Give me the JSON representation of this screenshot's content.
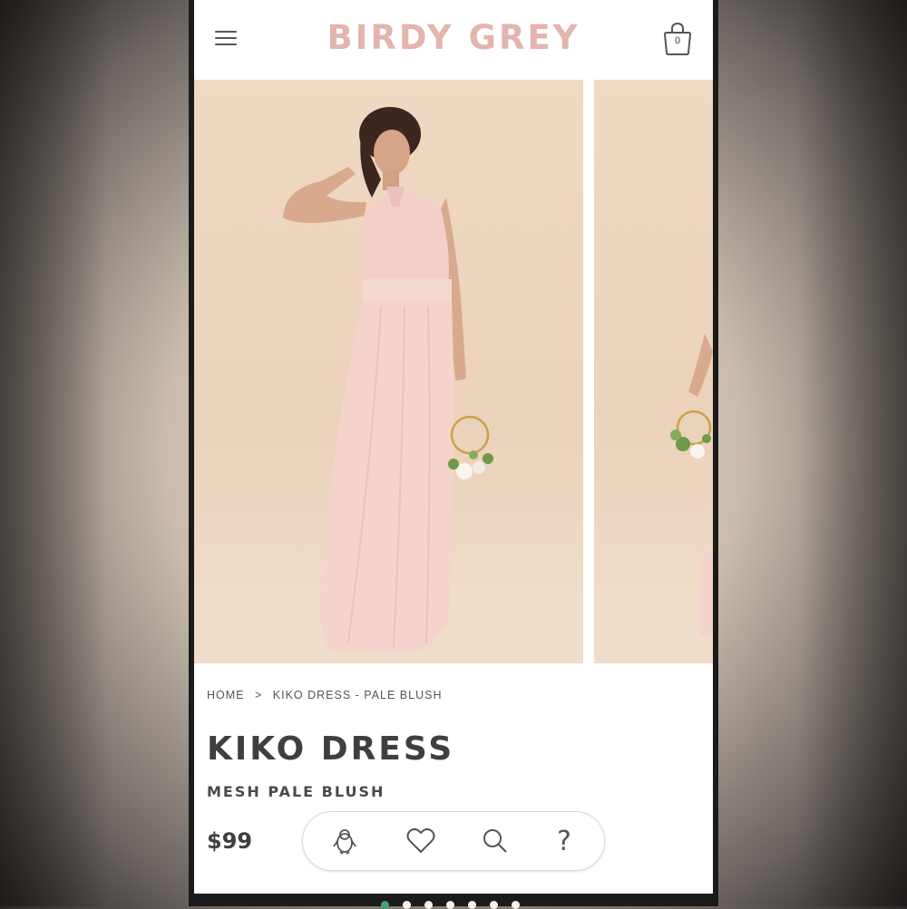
{
  "header": {
    "brand": "BIRDY GREY",
    "cart_count": "0",
    "menu_icon": "hamburger-icon",
    "cart_icon": "shopping-bag-icon",
    "brand_color": "#e3b5ad"
  },
  "gallery": {
    "images": [
      {
        "alt": "Model wearing Kiko Dress in Pale Blush holding a floral hoop"
      },
      {
        "alt": "Kiko Dress in Pale Blush, next image"
      }
    ],
    "background_color": "#ecd5bf",
    "dress_color": "#f4d3cc"
  },
  "breadcrumb": {
    "items": [
      "HOME",
      "KIKO DRESS - PALE BLUSH"
    ],
    "separator": ">"
  },
  "product": {
    "name": "KIKO DRESS",
    "variant": "MESH PALE BLUSH",
    "price": "$99"
  },
  "action_bar": {
    "buttons": [
      {
        "name": "penguin-icon"
      },
      {
        "name": "heart-icon"
      },
      {
        "name": "search-icon"
      },
      {
        "name": "help-icon",
        "label": "?"
      }
    ]
  },
  "pager": {
    "active_index": 0,
    "active_color": "#3aa37a"
  }
}
